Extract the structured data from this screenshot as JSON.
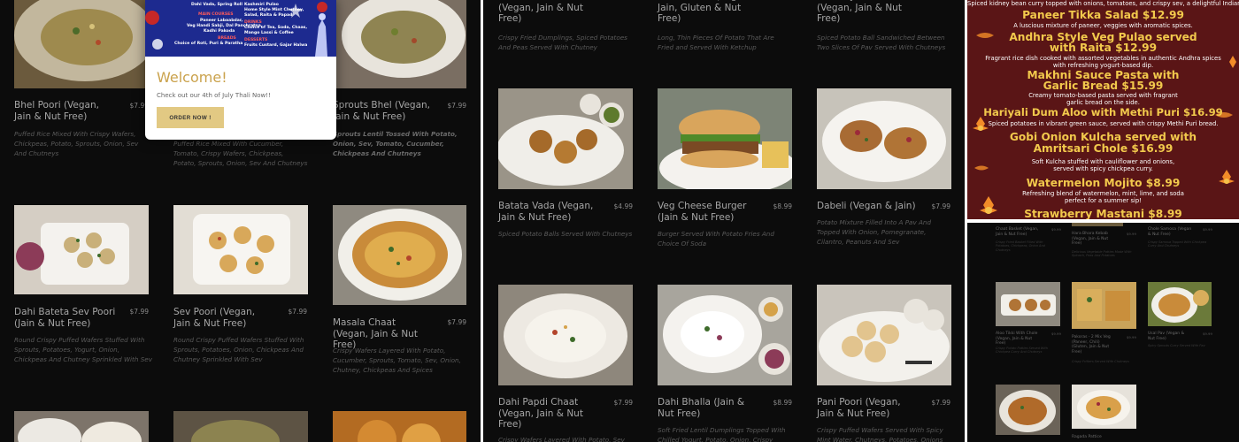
{
  "panel1": {
    "popup": {
      "banner": {
        "top_line": "Dahi Vada, Spring Roll",
        "left_header": "MAIN COURSES",
        "left_items": [
          "Paneer Labaabdar,",
          "Veg Handi Sabji, Dal Panchratna,",
          "Kadhi Pakoda"
        ],
        "left_breads_header": "BREADS",
        "left_breads": "Choice of Roti, Puri & Paratha",
        "right_items": [
          "Kashmiri Pulao",
          "Home Style Mint Chutney,",
          "Salad, Raita & Papad"
        ],
        "drinks_header": "DRINKS",
        "drinks": [
          "Choice of Tea, Soda, Chaas,",
          "Mango Lassi & Coffee"
        ],
        "desserts_header": "DESSERTS",
        "desserts": "Fruits Custard, Gajar Halwa"
      },
      "title": "Welcome!",
      "subtitle": "Check out our 4th of July Thali Now!!",
      "button": "ORDER NOW !"
    },
    "items": [
      {
        "name": "Bhel Poori (Vegan, Jain & Nut Free)",
        "price": "$7.99",
        "desc": "Puffed Rice Mixed With Crispy Wafers, Chickpeas, Potato, Sprouts, Onion, Sev And Chutneys"
      },
      {
        "name": "",
        "price": "",
        "desc": "Puffed Rice Mixed With Cucumber, Tomato, Crispy Wafers, Chickpeas, Potato, Sprouts, Onion, Sev And Chutneys"
      },
      {
        "name": "Sprouts Bhel (Vegan, Jain & Nut Free)",
        "price": "$7.99",
        "desc": "Sprouts Lentil Tossed With Potato, Onion, Sev, Tomato, Cucumber, Chickpeas And Chutneys"
      },
      {
        "name": "Dahi Bateta Sev Poori (Jain & Nut Free)",
        "price": "$7.99",
        "desc": "Round Crispy Puffed Wafers Stuffed With Sprouts, Potatoes, Yogurt, Onion, Chickpeas And Chutney Sprinkled With Sev"
      },
      {
        "name": "Sev Poori (Vegan, Jain & Nut Free)",
        "price": "$7.99",
        "desc": "Round Crispy Puffed Wafers Stuffed With Sprouts, Potatoes, Onion, Chickpeas And Chutney Sprinkled With Sev"
      },
      {
        "name": "Masala Chaat (Vegan, Jain & Nut Free)",
        "price": "$7.99",
        "desc": "Crispy Wafers Layered With Potato, Cucumber, Sprouts, Tomato, Sev, Onion, Chutney, Chickpeas And Spices"
      }
    ]
  },
  "panel2": {
    "items": [
      {
        "name": "Potato Peas Samosa (Vegan, Jain & Nut Free)",
        "price": "$4.99",
        "desc": "Crispy Fried Dumplings, Spiced Potatoes And Peas Served With Chutney"
      },
      {
        "name": "French Fries (Vegan, Jain, Gluten & Nut Free)",
        "price": "$4.99",
        "desc": "Long, Thin Pieces Of Potato That Are Fried and Served With Ketchup"
      },
      {
        "name": "Bombay Vada Pav (Vegan, Jain & Nut Free)",
        "price": "$4.99",
        "desc": "Spiced Potato Ball Sandwiched Between Two Slices Of Pav Served With Chutneys"
      },
      {
        "name": "Batata Vada (Vegan, Jain & Nut Free)",
        "price": "$4.99",
        "desc": "Spiced Potato Balls Served With Chutneys"
      },
      {
        "name": "Veg Cheese Burger (Jain & Nut Free)",
        "price": "$8.99",
        "desc": "Burger Served With Potato Fries And Choice Of Soda"
      },
      {
        "name": "Dabeli (Vegan & Jain)",
        "price": "$7.99",
        "desc": "Potato Mixture Filled Into A Pav And Topped With Onion, Pomegranate, Cilantro, Peanuts And Sev"
      },
      {
        "name": "Dahi Papdi Chaat (Vegan, Jain & Nut Free)",
        "price": "$7.99",
        "desc": "Crispy Wafers Layered With Potato, Sev"
      },
      {
        "name": "Dahi Bhalla (Jain & Nut Free)",
        "price": "$8.99",
        "desc": "Soft Fried Lentil Dumplings Topped With Chilled Yogurt, Potato, Onion, Crispy"
      },
      {
        "name": "Pani Poori (Vegan, Jain & Nut Free)",
        "price": "$7.99",
        "desc": "Crispy Puffed Wafers Served With Spicy Mint Water, Chutneys, Potatoes, Onions"
      }
    ]
  },
  "panel3": {
    "top_desc": "Spiced kidney bean curry topped with onions, tomatoes, and crispy sev, a delightful Indian street snack.",
    "items": [
      {
        "title": "Paneer Tikka Salad $12.99",
        "desc": [
          "A luscious mixture of paneer, veggies with aromatic spices."
        ]
      },
      {
        "title": "Andhra Style Veg Pulao served",
        "title2": "with Raita $12.99",
        "desc": [
          "Fragrant rice dish cooked with assorted vegetables in  authentic Andhra spices",
          "with refreshing yogurt-based dip."
        ]
      },
      {
        "title": "Makhni Sauce Pasta with",
        "title2": "Garlic Bread $15.99",
        "desc": [
          "Creamy tomato-based pasta served with fragrant",
          "garlic bread on the side."
        ]
      },
      {
        "title": "Hariyali Dum Aloo with Methi Puri $16.99",
        "desc": [
          "Spiced potatoes in vibrant green sauce, served with crispy Methi Puri bread."
        ]
      },
      {
        "title": "Gobi Onion Kulcha served with",
        "title2": "Amritsari Chole $16.99",
        "desc": [
          "Soft Kulcha stuffed with cauliflower and onions,",
          "served with spicy chickpea curry."
        ]
      },
      {
        "title": "Watermelon Mojito $8.99",
        "desc": [
          "Refreshing blend of watermelon, mint, lime, and soda",
          "perfect for a summer sip!"
        ]
      },
      {
        "title": "Strawberry Mastani $8.99",
        "desc": []
      }
    ]
  },
  "panel4": {
    "items": [
      {
        "name": "Chaat Basket (Vegan, Jain & Nut Free)",
        "price": "$9.99",
        "desc": "Crispy Fried Basket Filled With Potatoes, Chickpeas, Onion And Chutneys"
      },
      {
        "name": "Hara Bhara Kebab (Vegan, Jain & Nut Free)",
        "price": "$9.99",
        "desc": "Delicious Vegetable Patties Made With Spinach, Peas And Potatoes"
      },
      {
        "name": "Chole Samosa (Vegan & Nut Free)",
        "price": "$9.99",
        "desc": "Crispy Samosa Topped With Chickpea Curry And Chutneys"
      },
      {
        "name": "Aloo Tikki With Chole (Vegan, Jain & Nut Free)",
        "price": "$9.99",
        "desc": "Crispy Potato Patties Served With Chickpea Curry And Chutneys"
      },
      {
        "name": "Pakoras - 2 Mix Veg (Paneer, Chili) (Gluten, Jain & Nut Free)",
        "price": "$9.99",
        "desc": "Crispy Fritters Served With Chutneys"
      },
      {
        "name": "Usal Pav (Vegan & Nut Free)",
        "price": "$9.99",
        "desc": "Spicy Sprouts Curry Served With Pav"
      },
      {
        "name": "",
        "price": "",
        "desc": ""
      },
      {
        "name": "Ragada Pattice",
        "price": "",
        "desc": ""
      }
    ]
  },
  "colors": {
    "background": "#0c0c0c",
    "accent_gold": "#caa24c",
    "button_gold": "#e2c983",
    "poster_maroon": "#5a1516",
    "poster_yellow": "#f2c94c"
  }
}
